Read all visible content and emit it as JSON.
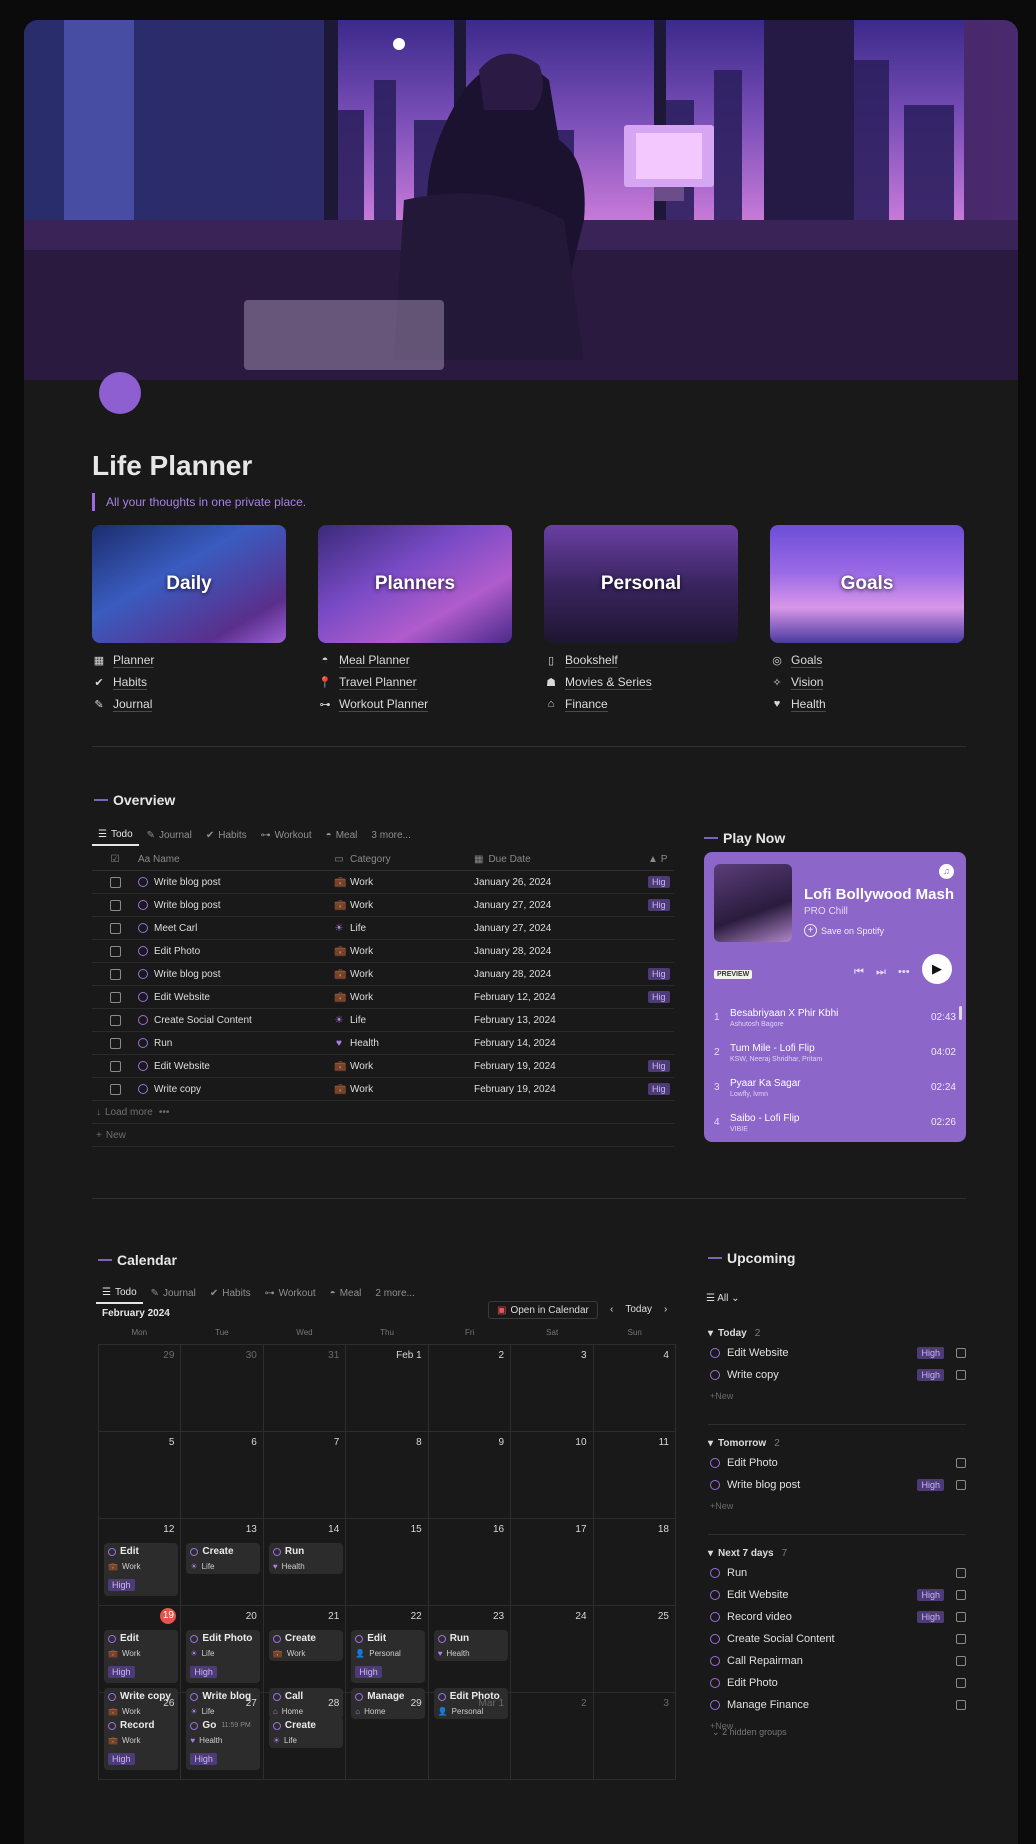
{
  "title": "Life Planner",
  "subtitle": "All your thoughts in one private place.",
  "categories": [
    {
      "label": "Daily",
      "links": [
        {
          "icon": "calendar-icon",
          "glyph": "▦",
          "label": "Planner"
        },
        {
          "icon": "check-circle-icon",
          "glyph": "✔",
          "label": "Habits"
        },
        {
          "icon": "pen-icon",
          "glyph": "✎",
          "label": "Journal"
        }
      ]
    },
    {
      "label": "Planners",
      "links": [
        {
          "icon": "bowl-icon",
          "glyph": "◓",
          "label": "Meal Planner"
        },
        {
          "icon": "pin-icon",
          "glyph": "📍",
          "label": "Travel Planner"
        },
        {
          "icon": "dumbbell-icon",
          "glyph": "⊶",
          "label": "Workout Planner"
        }
      ]
    },
    {
      "label": "Personal",
      "links": [
        {
          "icon": "book-icon",
          "glyph": "▯",
          "label": "Bookshelf"
        },
        {
          "icon": "popcorn-icon",
          "glyph": "☗",
          "label": "Movies & Series"
        },
        {
          "icon": "bank-icon",
          "glyph": "⌂",
          "label": "Finance"
        }
      ]
    },
    {
      "label": "Goals",
      "links": [
        {
          "icon": "target-icon",
          "glyph": "◎",
          "label": "Goals"
        },
        {
          "icon": "sparkle-icon",
          "glyph": "✧",
          "label": "Vision"
        },
        {
          "icon": "heart-icon",
          "glyph": "♥",
          "label": "Health"
        }
      ]
    }
  ],
  "overview": {
    "heading": "Overview",
    "tabs": [
      "Todo",
      "Journal",
      "Habits",
      "Workout",
      "Meal",
      "3 more..."
    ],
    "columns": [
      "Aa Name",
      "Category",
      "Due Date",
      "P"
    ],
    "rows": [
      {
        "name": "Write blog post",
        "category": "Work",
        "due": "January 26, 2024",
        "priority": "Hig"
      },
      {
        "name": "Write blog post",
        "category": "Work",
        "due": "January 27, 2024",
        "priority": "Hig"
      },
      {
        "name": "Meet Carl",
        "category": "Life",
        "due": "January 27, 2024",
        "priority": ""
      },
      {
        "name": "Edit Photo",
        "category": "Work",
        "due": "January 28, 2024",
        "priority": ""
      },
      {
        "name": "Write blog post",
        "category": "Work",
        "due": "January 28, 2024",
        "priority": "Hig"
      },
      {
        "name": "Edit Website",
        "category": "Work",
        "due": "February 12, 2024",
        "priority": "Hig"
      },
      {
        "name": "Create Social Content",
        "category": "Life",
        "due": "February 13, 2024",
        "priority": ""
      },
      {
        "name": "Run",
        "category": "Health",
        "due": "February 14, 2024",
        "priority": ""
      },
      {
        "name": "Edit Website",
        "category": "Work",
        "due": "February 19, 2024",
        "priority": "Hig"
      },
      {
        "name": "Write copy",
        "category": "Work",
        "due": "February 19, 2024",
        "priority": "Hig"
      }
    ],
    "load_more": "Load more",
    "new": "New"
  },
  "player": {
    "heading": "Play Now",
    "title": "Lofi Bollywood Mash",
    "owner": "PRO Chill",
    "save": "Save on Spotify",
    "preview": "PREVIEW",
    "tracks": [
      {
        "n": "1",
        "title": "Besabriyaan X Phir Kbhi",
        "artist": "Ashutosh Bagore",
        "dur": "02:43"
      },
      {
        "n": "2",
        "title": "Tum Mile - Lofi Flip",
        "artist": "KSW, Neeraj Shridhar, Pritam",
        "dur": "04:02"
      },
      {
        "n": "3",
        "title": "Pyaar Ka Sagar",
        "artist": "Lowfly, lvmn",
        "dur": "02:24"
      },
      {
        "n": "4",
        "title": "Saibo - Lofi Flip",
        "artist": "VIBIE",
        "dur": "02:26"
      }
    ]
  },
  "calendar": {
    "heading": "Calendar",
    "tabs": [
      "Todo",
      "Journal",
      "Habits",
      "Workout",
      "Meal",
      "2 more..."
    ],
    "month": "February 2024",
    "open_btn": "Open in Calendar",
    "today_btn": "Today",
    "dow": [
      "Mon",
      "Tue",
      "Wed",
      "Thu",
      "Fri",
      "Sat",
      "Sun"
    ],
    "weeks": [
      [
        {
          "d": "29",
          "dim": true
        },
        {
          "d": "30",
          "dim": true
        },
        {
          "d": "31",
          "dim": true
        },
        {
          "d": "Feb 1"
        },
        {
          "d": "2"
        },
        {
          "d": "3"
        },
        {
          "d": "4"
        }
      ],
      [
        {
          "d": "5"
        },
        {
          "d": "6"
        },
        {
          "d": "7"
        },
        {
          "d": "8"
        },
        {
          "d": "9"
        },
        {
          "d": "10"
        },
        {
          "d": "11"
        }
      ],
      [
        {
          "d": "12",
          "ev": [
            {
              "t": "Edit",
              "c": "Work",
              "p": "High"
            }
          ]
        },
        {
          "d": "13",
          "ev": [
            {
              "t": "Create",
              "c": "Life"
            }
          ]
        },
        {
          "d": "14",
          "ev": [
            {
              "t": "Run",
              "c": "Health"
            }
          ]
        },
        {
          "d": "15"
        },
        {
          "d": "16"
        },
        {
          "d": "17"
        },
        {
          "d": "18"
        }
      ],
      [
        {
          "d": "19",
          "today": true,
          "ev": [
            {
              "t": "Edit",
              "c": "Work",
              "p": "High"
            },
            {
              "t": "Write copy",
              "c": "Work",
              "p": "High"
            }
          ]
        },
        {
          "d": "20",
          "ev": [
            {
              "t": "Edit Photo",
              "c": "Life",
              "p": "High"
            },
            {
              "t": "Write blog",
              "c": "Life",
              "p": "High"
            }
          ]
        },
        {
          "d": "21",
          "ev": [
            {
              "t": "Create",
              "c": "Work"
            },
            {
              "t": "Call",
              "c": "Home"
            }
          ]
        },
        {
          "d": "22",
          "ev": [
            {
              "t": "Edit",
              "c": "Personal",
              "p": "High"
            },
            {
              "t": "Manage",
              "c": "Home"
            }
          ]
        },
        {
          "d": "23",
          "ev": [
            {
              "t": "Run",
              "c": "Health"
            },
            {
              "t": "Edit Photo",
              "c": "Personal"
            }
          ]
        },
        {
          "d": "24"
        },
        {
          "d": "25"
        }
      ],
      [
        {
          "d": "26",
          "ev": [
            {
              "t": "Record",
              "c": "Work",
              "p": "High"
            }
          ]
        },
        {
          "d": "27",
          "ev": [
            {
              "t": "Go",
              "time": "11:59 PM",
              "c": "Health",
              "p": "High"
            }
          ]
        },
        {
          "d": "28",
          "ev": [
            {
              "t": "Create",
              "c": "Life"
            }
          ]
        },
        {
          "d": "29"
        },
        {
          "d": "Mar 1",
          "dim": true
        },
        {
          "d": "2",
          "dim": true
        },
        {
          "d": "3",
          "dim": true
        }
      ]
    ]
  },
  "upcoming": {
    "heading": "Upcoming",
    "filter": "All",
    "groups": [
      {
        "name": "Today",
        "count": "2",
        "items": [
          {
            "t": "Edit Website",
            "p": "High"
          },
          {
            "t": "Write copy",
            "p": "High"
          }
        ]
      },
      {
        "name": "Tomorrow",
        "count": "2",
        "items": [
          {
            "t": "Edit Photo",
            "p": ""
          },
          {
            "t": "Write blog post",
            "p": "High"
          }
        ]
      },
      {
        "name": "Next 7 days",
        "count": "7",
        "items": [
          {
            "t": "Run",
            "p": ""
          },
          {
            "t": "Edit Website",
            "p": "High"
          },
          {
            "t": "Record video",
            "p": "High"
          },
          {
            "t": "Create Social Content",
            "p": ""
          },
          {
            "t": "Call Repairman",
            "p": ""
          },
          {
            "t": "Edit Photo",
            "p": ""
          },
          {
            "t": "Manage Finance",
            "p": ""
          }
        ]
      }
    ],
    "new": "New",
    "hidden": "2 hidden groups"
  },
  "colors": {
    "accent": "#9d6ae0",
    "player": "#8c66c9",
    "today": "#e5534b",
    "pill": "#4d3b78"
  }
}
